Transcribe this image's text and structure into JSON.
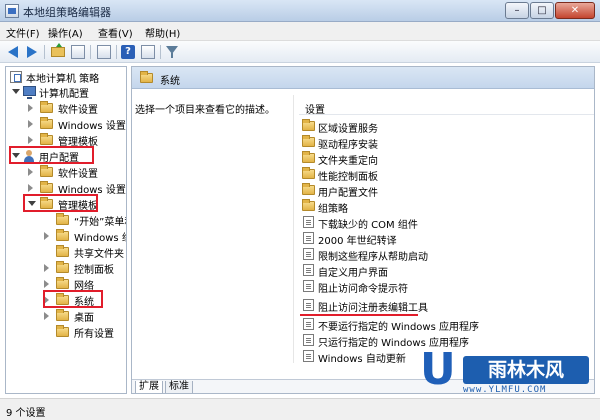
{
  "window": {
    "title": "本地组策略编辑器",
    "min": "–",
    "max": "□",
    "close": "✕"
  },
  "menu": [
    "文件(F)",
    "操作(A)",
    "查看(V)",
    "帮助(H)"
  ],
  "toolbar": [
    "back-arrow-icon",
    "forward-arrow-icon",
    "up-folder-icon",
    "show-hide-tree-icon",
    "export-list-icon",
    "help-icon",
    "properties-icon",
    "filter-icon"
  ],
  "tree": {
    "root": "本地计算机 策略",
    "computer_config": "计算机配置",
    "cc_software": "软件设置",
    "cc_windows": "Windows 设置",
    "cc_admin": "管理模板",
    "user_config": "用户配置",
    "uc_software": "软件设置",
    "uc_windows": "Windows 设置",
    "uc_admin": "管理模板",
    "start_menu": "“开始”菜单和任务栏",
    "windows_components": "Windows 组件",
    "shared_folders": "共享文件夹",
    "control_panel": "控制面板",
    "network": "网络",
    "system": "系统",
    "desktop": "桌面",
    "all_settings": "所有设置"
  },
  "right": {
    "header": "系统",
    "description": "选择一个项目来查看它的描述。",
    "column": "设置",
    "items": [
      "区域设置服务",
      "驱动程序安装",
      "文件夹重定向",
      "性能控制面板",
      "用户配置文件",
      "组策略",
      "下载缺少的 COM 组件",
      "2000 年世纪转译",
      "限制这些程序从帮助启动",
      "自定义用户界面",
      "阻止访问命令提示符",
      "阻止访问注册表编辑工具",
      "不要运行指定的 Windows 应用程序",
      "只运行指定的 Windows 应用程序",
      "Windows 自动更新"
    ]
  },
  "tabs": {
    "extended": "扩展",
    "standard": "标准"
  },
  "status": "9 个设置",
  "watermark": {
    "logo": "U",
    "brand": "雨林木风",
    "url": "www.YLMFU.COM"
  },
  "colors": {
    "highlight_red": "#e11d2b",
    "brand_blue": "#1d5eaf"
  }
}
